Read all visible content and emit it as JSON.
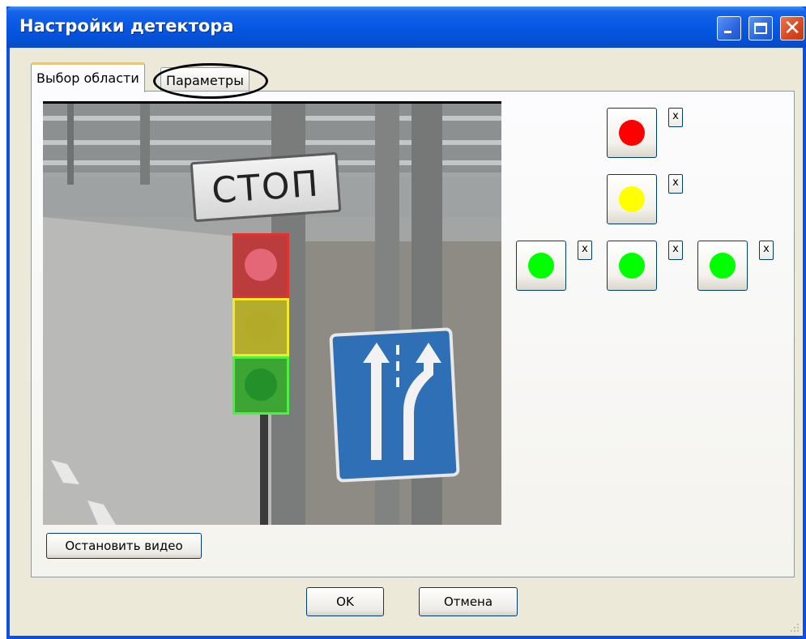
{
  "window": {
    "title": "Настройки детектора"
  },
  "tabs": [
    {
      "label": "Выбор области",
      "active": true
    },
    {
      "label": "Параметры",
      "active": false
    }
  ],
  "video": {
    "sign_text": "СТОП"
  },
  "stop_video_label": "Остановить видео",
  "signals": [
    {
      "color": "#ff0000",
      "remove_label": "x"
    },
    {
      "color": "#ffff00",
      "remove_label": "x"
    },
    {
      "color": "#00ff00",
      "remove_label": "x"
    },
    {
      "color": "#00ff00",
      "remove_label": "x"
    },
    {
      "color": "#00ff00",
      "remove_label": "x"
    }
  ],
  "footer": {
    "ok_label": "OK",
    "cancel_label": "Отмена"
  }
}
